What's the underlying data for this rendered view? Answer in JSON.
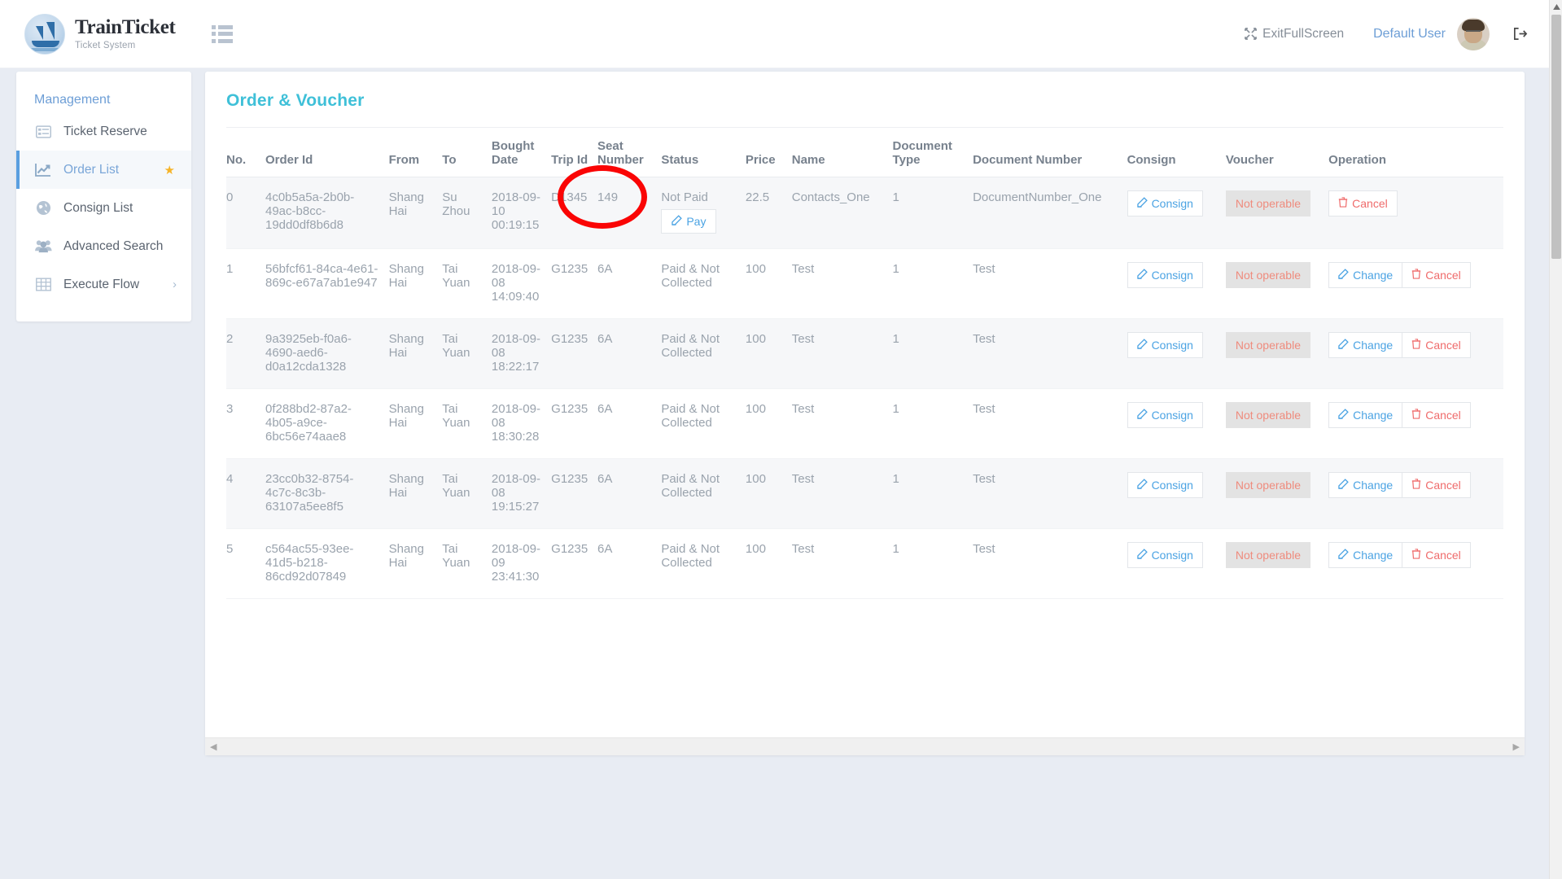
{
  "header": {
    "brand_title": "TrainTicket",
    "brand_subtitle": "Ticket System",
    "menu_toggle_icon": "hamburger-icon",
    "exit_fullscreen_label": "ExitFullScreen",
    "exit_fullscreen_icon": "compress-arrows-icon",
    "user_name": "Default User",
    "avatar_icon": "user-avatar",
    "logout_icon": "sign-out-icon"
  },
  "sidebar": {
    "heading": "Management",
    "items": [
      {
        "label": "Ticket Reserve",
        "icon": "list-alt-icon",
        "active": false,
        "starred": false,
        "chevron": false
      },
      {
        "label": "Order List",
        "icon": "chart-line-icon",
        "active": true,
        "starred": true,
        "chevron": false
      },
      {
        "label": "Consign List",
        "icon": "globe-icon",
        "active": false,
        "starred": false,
        "chevron": false
      },
      {
        "label": "Advanced Search",
        "icon": "users-icon",
        "active": false,
        "starred": false,
        "chevron": false
      },
      {
        "label": "Execute Flow",
        "icon": "table-icon",
        "active": false,
        "starred": false,
        "chevron": true
      }
    ],
    "star_glyph": "★",
    "chevron_glyph": "›"
  },
  "main": {
    "panel_title": "Order & Voucher",
    "columns": [
      "No.",
      "Order Id",
      "From",
      "To",
      "Bought Date",
      "Trip Id",
      "Seat Number",
      "Status",
      "Price",
      "Name",
      "Document Type",
      "Document Number",
      "Consign",
      "Voucher",
      "Operation"
    ],
    "buttons": {
      "consign": "Consign",
      "pay": "Pay",
      "not_operable": "Not operable",
      "change": "Change",
      "cancel": "Cancel",
      "edit_icon": "edit-pencil-icon",
      "trash_icon": "trash-icon"
    },
    "rows": [
      {
        "no": "0",
        "order_id": "4c0b5a5a-2b0b-49ac-b8cc-19dd0df8b6d8",
        "from": "Shang Hai",
        "to": "Su Zhou",
        "bought_date": "2018-09-10 00:19:15",
        "trip_id": "D1345",
        "seat_number": "149",
        "status": "Not Paid",
        "has_pay": true,
        "price": "22.5",
        "name": "Contacts_One",
        "document_type": "1",
        "document_number": "DocumentNumber_One",
        "has_change": false
      },
      {
        "no": "1",
        "order_id": "56bfcf61-84ca-4e61-869c-e67a7ab1e947",
        "from": "Shang Hai",
        "to": "Tai Yuan",
        "bought_date": "2018-09-08 14:09:40",
        "trip_id": "G1235",
        "seat_number": "6A",
        "status": "Paid & Not Collected",
        "has_pay": false,
        "price": "100",
        "name": "Test",
        "document_type": "1",
        "document_number": "Test",
        "has_change": true
      },
      {
        "no": "2",
        "order_id": "9a3925eb-f0a6-4690-aed6-d0a12cda1328",
        "from": "Shang Hai",
        "to": "Tai Yuan",
        "bought_date": "2018-09-08 18:22:17",
        "trip_id": "G1235",
        "seat_number": "6A",
        "status": "Paid & Not Collected",
        "has_pay": false,
        "price": "100",
        "name": "Test",
        "document_type": "1",
        "document_number": "Test",
        "has_change": true
      },
      {
        "no": "3",
        "order_id": "0f288bd2-87a2-4b05-a9ce-6bc56e74aae8",
        "from": "Shang Hai",
        "to": "Tai Yuan",
        "bought_date": "2018-09-08 18:30:28",
        "trip_id": "G1235",
        "seat_number": "6A",
        "status": "Paid & Not Collected",
        "has_pay": false,
        "price": "100",
        "name": "Test",
        "document_type": "1",
        "document_number": "Test",
        "has_change": true
      },
      {
        "no": "4",
        "order_id": "23cc0b32-8754-4c7c-8c3b-63107a5ee8f5",
        "from": "Shang Hai",
        "to": "Tai Yuan",
        "bought_date": "2018-09-08 19:15:27",
        "trip_id": "G1235",
        "seat_number": "6A",
        "status": "Paid & Not Collected",
        "has_pay": false,
        "price": "100",
        "name": "Test",
        "document_type": "1",
        "document_number": "Test",
        "has_change": true
      },
      {
        "no": "5",
        "order_id": "c564ac55-93ee-41d5-b218-86cd92d07849",
        "from": "Shang Hai",
        "to": "Tai Yuan",
        "bought_date": "2018-09-09 23:41:30",
        "trip_id": "G1235",
        "seat_number": "6A",
        "status": "Paid & Not Collected",
        "has_pay": false,
        "price": "100",
        "name": "Test",
        "document_type": "1",
        "document_number": "Test",
        "has_change": true
      }
    ],
    "hscroll": {
      "left_glyph": "◀",
      "right_glyph": "▶"
    }
  },
  "annotation": {
    "shape": "red-circle-highlight",
    "color": "#fa0505"
  },
  "colors": {
    "accent_title": "#3fc0d8",
    "link_blue": "#4ba3e3",
    "danger_red": "#ef6b6b",
    "star_gold": "#f6b429",
    "page_bg": "#e8ecf3"
  }
}
